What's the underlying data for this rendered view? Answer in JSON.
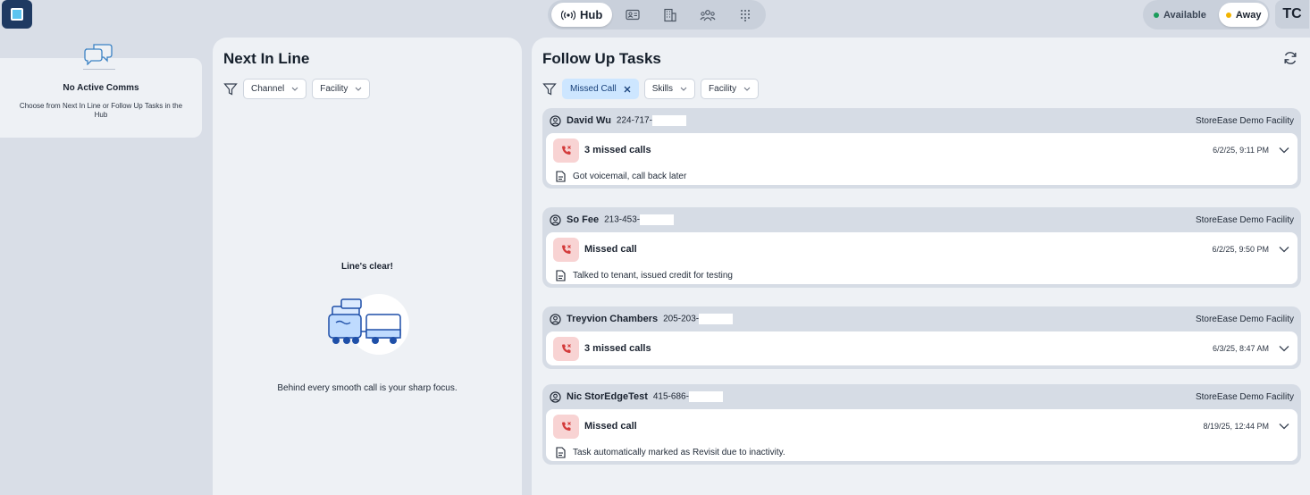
{
  "header": {
    "nav_hub_label": "Hub",
    "status_available": "Available",
    "status_away": "Away",
    "avatar_initials": "TC",
    "colors": {
      "available": "#1a9c5b",
      "away": "#f2b400",
      "brand": "#1f3a62"
    }
  },
  "comms": {
    "title": "No Active Comms",
    "subtitle": "Choose from Next In Line or Follow Up Tasks in the Hub"
  },
  "next_in_line": {
    "title": "Next In Line",
    "filters": [
      "Channel",
      "Facility"
    ],
    "empty_title": "Line's clear!",
    "empty_subtitle": "Behind every smooth call is your sharp focus."
  },
  "follow_up": {
    "title": "Follow Up Tasks",
    "active_filter": "Missed Call",
    "filters": [
      "Skills",
      "Facility"
    ],
    "tasks": [
      {
        "name": "David Wu",
        "phone": "224-717-",
        "facility": "StoreEase Demo Facility",
        "call_label": "3 missed calls",
        "time": "6/2/25, 9:11 PM",
        "note": "Got voicemail, call back later"
      },
      {
        "name": "So Fee",
        "phone": "213-453-",
        "facility": "StoreEase Demo Facility",
        "call_label": "Missed call",
        "time": "6/2/25, 9:50 PM",
        "note": "Talked to tenant, issued credit for testing"
      },
      {
        "name": "Treyvion Chambers",
        "phone": "205-203-",
        "facility": "StoreEase Demo Facility",
        "call_label": "3 missed calls",
        "time": "6/3/25, 8:47 AM",
        "note": ""
      },
      {
        "name": "Nic StorEdgeTest",
        "phone": "415-686-",
        "facility": "StoreEase Demo Facility",
        "call_label": "Missed call",
        "time": "8/19/25, 12:44 PM",
        "note": "Task automatically marked as Revisit due to inactivity."
      }
    ]
  }
}
